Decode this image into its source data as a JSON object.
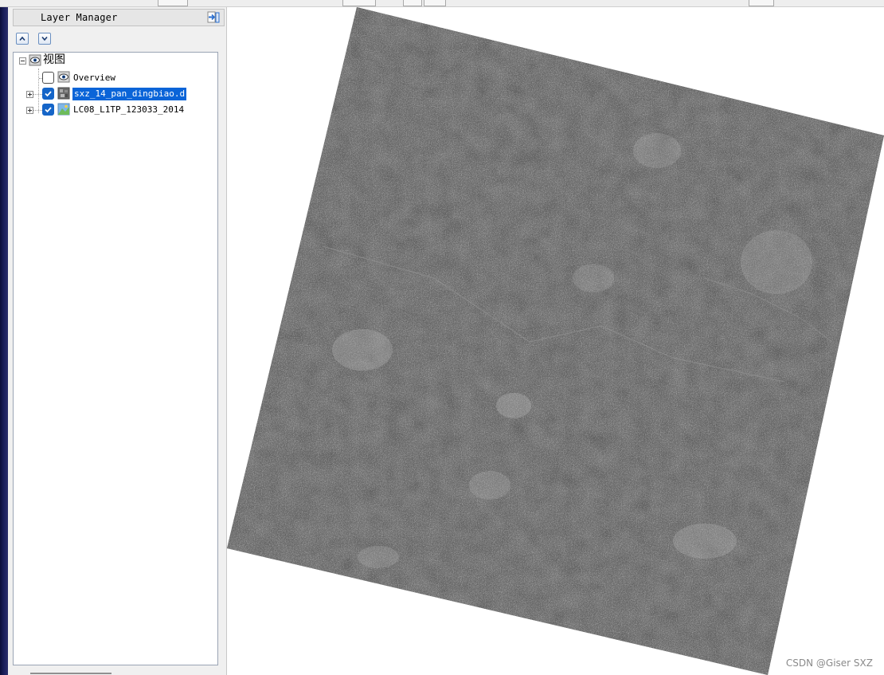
{
  "layer_manager": {
    "title": "Layer Manager",
    "pin_icon": "pin-icon",
    "move_up_icon": "arrow-up-icon",
    "move_down_icon": "arrow-down-icon",
    "root": {
      "label": "视图",
      "icon": "eye-icon"
    },
    "layers": [
      {
        "label": "Overview",
        "checked": false,
        "icon": "eye-icon",
        "selected": false
      },
      {
        "label": "sxz_14_pan_dingbiao.d",
        "checked": true,
        "icon": "raster-gray-icon",
        "selected": true
      },
      {
        "label": "LC08_L1TP_123033_2014",
        "checked": true,
        "icon": "raster-color-icon",
        "selected": false
      }
    ]
  },
  "map": {
    "content": "satellite-image",
    "background_color": "#ffffff"
  },
  "watermark": "CSDN @Giser SXZ"
}
